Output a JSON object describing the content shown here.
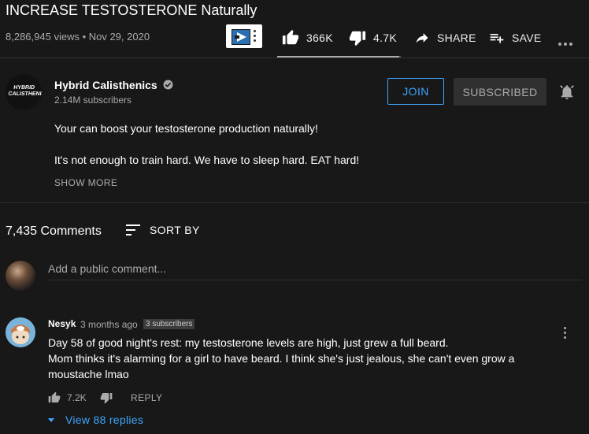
{
  "video": {
    "title": "INCREASE TESTOSTERONE Naturally",
    "meta": "8,286,945 views • Nov 29, 2020",
    "actions": {
      "like": "366K",
      "dislike": "4.7K",
      "share": "SHARE",
      "save": "SAVE"
    },
    "sentiment_fraction": 0.987
  },
  "channel": {
    "name": "Hybrid Calisthenics",
    "subs": "2.14M subscribers",
    "avatar_text": "HYBRID CALISTHENICS",
    "join": "JOIN",
    "subscribed": "SUBSCRIBED"
  },
  "description": {
    "line1": "Your can boost your testosterone production naturally!",
    "line2": "It's not enough to train hard. We have to sleep hard. EAT hard!",
    "show_more": "SHOW MORE"
  },
  "comments": {
    "count": "7,435 Comments",
    "sort_label": "SORT BY",
    "placeholder": "Add a public comment...",
    "items": [
      {
        "author": "Nesyk",
        "time": "3 months ago",
        "badge": "3 subscribers",
        "line1": "Day 58 of good night's rest: my testosterone levels are high, just grew a full beard.",
        "line2": "Mom thinks it's alarming for a girl to have beard. I think she's just jealous, she can't even grow a",
        "line3": "moustache lmao",
        "likes": "7.2K",
        "reply": "REPLY",
        "replies": "View 88 replies"
      }
    ]
  },
  "colors": {
    "background": "#181818",
    "accent_blue": "#3ea6ff",
    "muted": "#aaaaaa"
  }
}
